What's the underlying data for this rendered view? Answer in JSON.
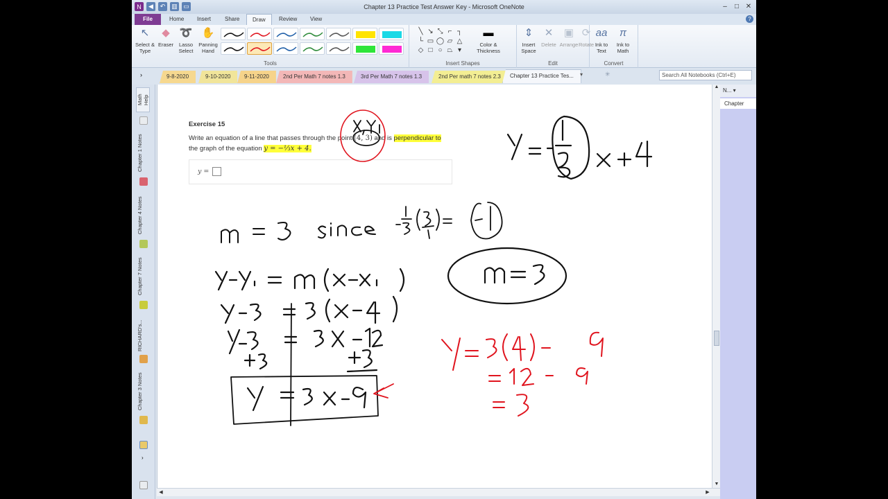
{
  "window": {
    "title": "Chapter 13 Practice Test Answer Key - Microsoft OneNote"
  },
  "ribbon_tabs": [
    "File",
    "Home",
    "Insert",
    "Share",
    "Draw",
    "Review",
    "View"
  ],
  "ribbon": {
    "select_type": "Select & Type",
    "eraser": "Eraser",
    "lasso": "Lasso Select",
    "panning": "Panning Hand",
    "tools_group": "Tools",
    "insert_shapes_group": "Insert Shapes",
    "color_thickness": "Color & Thickness",
    "insert_space": "Insert Space",
    "delete": "Delete",
    "arrange": "Arrange",
    "rotate": "Rotate",
    "edit_group": "Edit",
    "ink_to_text": "Ink to Text",
    "ink_to_math": "Ink to Math",
    "convert_group": "Convert"
  },
  "section_tabs": [
    {
      "label": "9-8-2020",
      "color": "#f6d88f"
    },
    {
      "label": "9-10-2020",
      "color": "#f1e59a"
    },
    {
      "label": "9-11-2020",
      "color": "#f6d38a"
    },
    {
      "label": "2nd Per Math 7 notes 1.3",
      "color": "#f3b7b7"
    },
    {
      "label": "3rd Per Math 7 notes 1.3",
      "color": "#d7c3ea"
    },
    {
      "label": "2nd Per math 7 notes 2.3",
      "color": "#f3ee93"
    },
    {
      "label": "Chapter 13 Practice Tes...",
      "color": "#f5f7fb"
    }
  ],
  "search": {
    "placeholder": "Search All Notebooks (Ctrl+E)"
  },
  "notebooks": [
    "Math Help",
    "Chapter 1 Notes",
    "Chapter 4 Notes",
    "Chapter 7 Notes",
    "RICHARD's...",
    "Chapter 3 Notes"
  ],
  "page_panel": {
    "header": "N...",
    "page": "Chapter"
  },
  "exercise": {
    "heading": "Exercise 15",
    "line1_pre": "Write an equation of a line that passes through the point",
    "point": "(4, 3)",
    "line1_mid": "and is",
    "perp": "perpendicular to",
    "line2_pre": "the graph of the equation",
    "equation": "y = −⅓x + 4.",
    "answer_prefix": "y ="
  },
  "ink_colors": {
    "black": "#111111",
    "red": "#e0141e",
    "highlight": "#ffff1e"
  }
}
